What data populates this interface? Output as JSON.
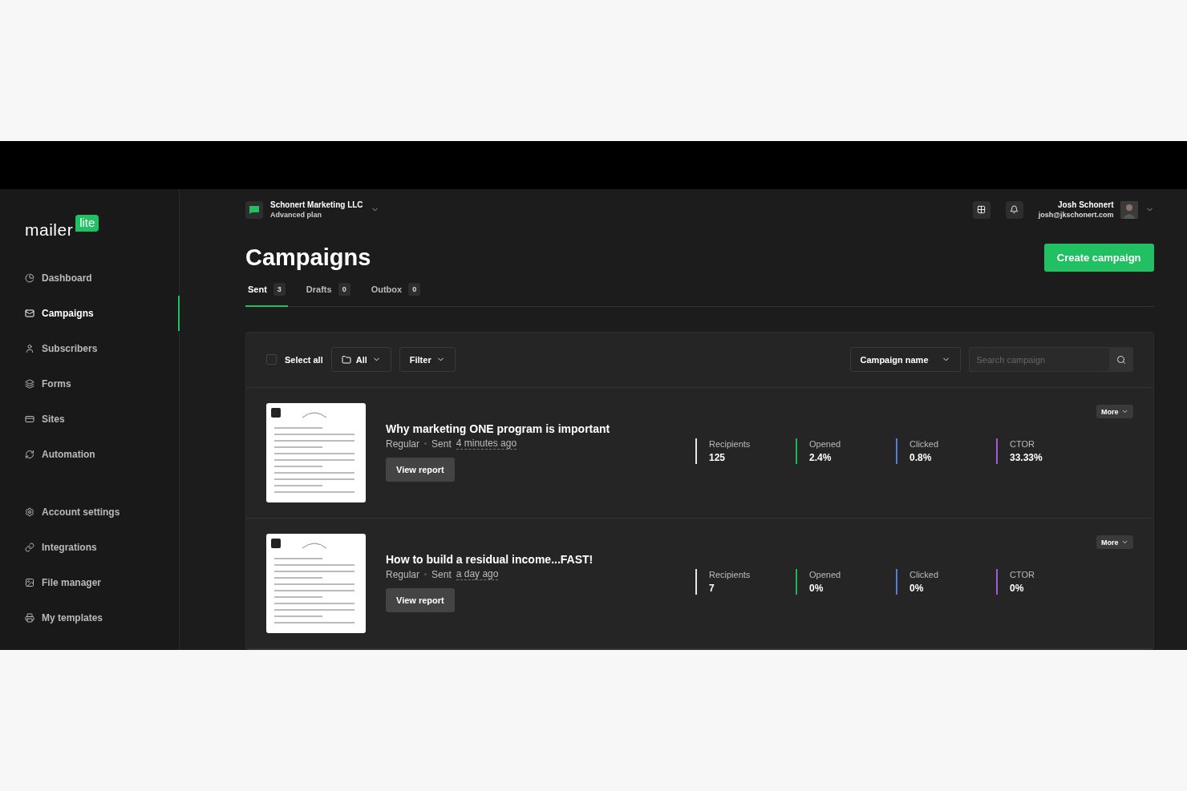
{
  "logo": {
    "word": "mailer",
    "badge": "lite"
  },
  "sidebar": {
    "sections": [
      {
        "items": [
          {
            "label": "Dashboard",
            "selected": false
          },
          {
            "label": "Campaigns",
            "selected": true
          },
          {
            "label": "Subscribers",
            "selected": false
          },
          {
            "label": "Forms",
            "selected": false
          },
          {
            "label": "Sites",
            "selected": false
          },
          {
            "label": "Automation",
            "selected": false
          }
        ]
      },
      {
        "items": [
          {
            "label": "Account settings",
            "selected": false
          },
          {
            "label": "Integrations",
            "selected": false
          },
          {
            "label": "File manager",
            "selected": false
          },
          {
            "label": "My templates",
            "selected": false
          }
        ]
      }
    ]
  },
  "account": {
    "name": "Schonert Marketing LLC",
    "plan": "Advanced plan"
  },
  "user": {
    "name": "Josh Schonert",
    "email": "josh@jkschonert.com"
  },
  "page_title": "Campaigns",
  "create_button": "Create campaign",
  "tabs": [
    {
      "label": "Sent",
      "count": "3",
      "selected": true
    },
    {
      "label": "Drafts",
      "count": "0",
      "selected": false
    },
    {
      "label": "Outbox",
      "count": "0",
      "selected": false
    }
  ],
  "toolbar": {
    "select_all": {
      "label": "Select all",
      "checked": false
    },
    "folder": "All",
    "filter": "Filter",
    "sort": "Campaign name",
    "search": {
      "placeholder": "Search campaign"
    }
  },
  "campaigns": [
    {
      "title": "Why marketing ONE program is important",
      "type": "Regular",
      "sent_label": "Sent",
      "sent_time": "4 minutes ago",
      "report_button": "View report",
      "more_button": "More",
      "stats": [
        {
          "label": "Recipients",
          "value": "125",
          "color": "#e6e6e6"
        },
        {
          "label": "Opened",
          "value": "2.4%",
          "color": "#22b05e"
        },
        {
          "label": "Clicked",
          "value": "0.8%",
          "color": "#4f7de0"
        },
        {
          "label": "CTOR",
          "value": "33.33%",
          "color": "#a35ad6"
        }
      ]
    },
    {
      "title": "How to build a residual income...FAST!",
      "type": "Regular",
      "sent_label": "Sent",
      "sent_time": "a day ago",
      "report_button": "View report",
      "more_button": "More",
      "stats": [
        {
          "label": "Recipients",
          "value": "7",
          "color": "#e6e6e6"
        },
        {
          "label": "Opened",
          "value": "0%",
          "color": "#22b05e"
        },
        {
          "label": "Clicked",
          "value": "0%",
          "color": "#4f7de0"
        },
        {
          "label": "CTOR",
          "value": "0%",
          "color": "#a35ad6"
        }
      ]
    }
  ]
}
